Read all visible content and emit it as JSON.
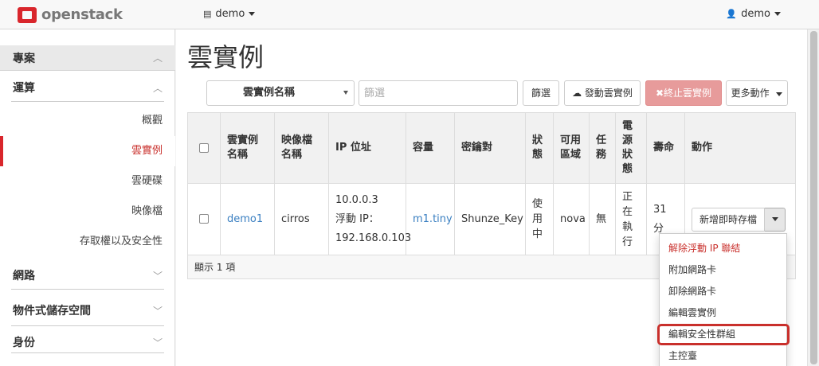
{
  "topbar": {
    "logo_text": "openstack",
    "project": "demo",
    "user": "demo"
  },
  "sidebar": {
    "project_header": "專案",
    "compute_header": "運算",
    "items": [
      {
        "label": "概觀"
      },
      {
        "label": "雲實例"
      },
      {
        "label": "雲硬碟"
      },
      {
        "label": "映像檔"
      },
      {
        "label": "存取權以及安全性"
      }
    ],
    "network_header": "網路",
    "object_storage_header": "物件式儲存空間",
    "identity_header": "身份"
  },
  "main": {
    "title": "雲實例",
    "toolbar": {
      "select_value": "雲實例名稱",
      "filter_placeholder": "篩選",
      "filter_button": "篩選",
      "launch_button": "發動雲實例",
      "terminate_button": "終止雲實例",
      "more_button": "更多動作"
    },
    "table": {
      "headers": [
        "雲實例名稱",
        "映像檔名稱",
        "IP 位址",
        "容量",
        "密鑰對",
        "狀態",
        "可用區域",
        "任務",
        "電源狀態",
        "壽命",
        "動作"
      ],
      "row": {
        "name": "demo1",
        "image": "cirros",
        "ip_line1": "10.0.0.3",
        "ip_line2": "浮動 IP：",
        "ip_line3": "192.168.0.103",
        "flavor": "m1.tiny",
        "keypair": "Shunze_Key",
        "status": "使用中",
        "zone": "nova",
        "task": "無",
        "power": "正在執行",
        "age": "31 分",
        "action_main": "新增即時存檔"
      },
      "footer": "顯示 1 項"
    },
    "dropdown": [
      {
        "label": "解除浮動 IP 聯結"
      },
      {
        "label": "附加網路卡"
      },
      {
        "label": "卸除網路卡"
      },
      {
        "label": "編輯雲實例"
      },
      {
        "label": "編輯安全性群組"
      },
      {
        "label": "主控臺"
      }
    ]
  },
  "colors": {
    "brand_red": "#d9262c",
    "link_blue": "#3a7fc1",
    "danger_button": "#e79b9b",
    "highlight_box": "#c9302c"
  }
}
